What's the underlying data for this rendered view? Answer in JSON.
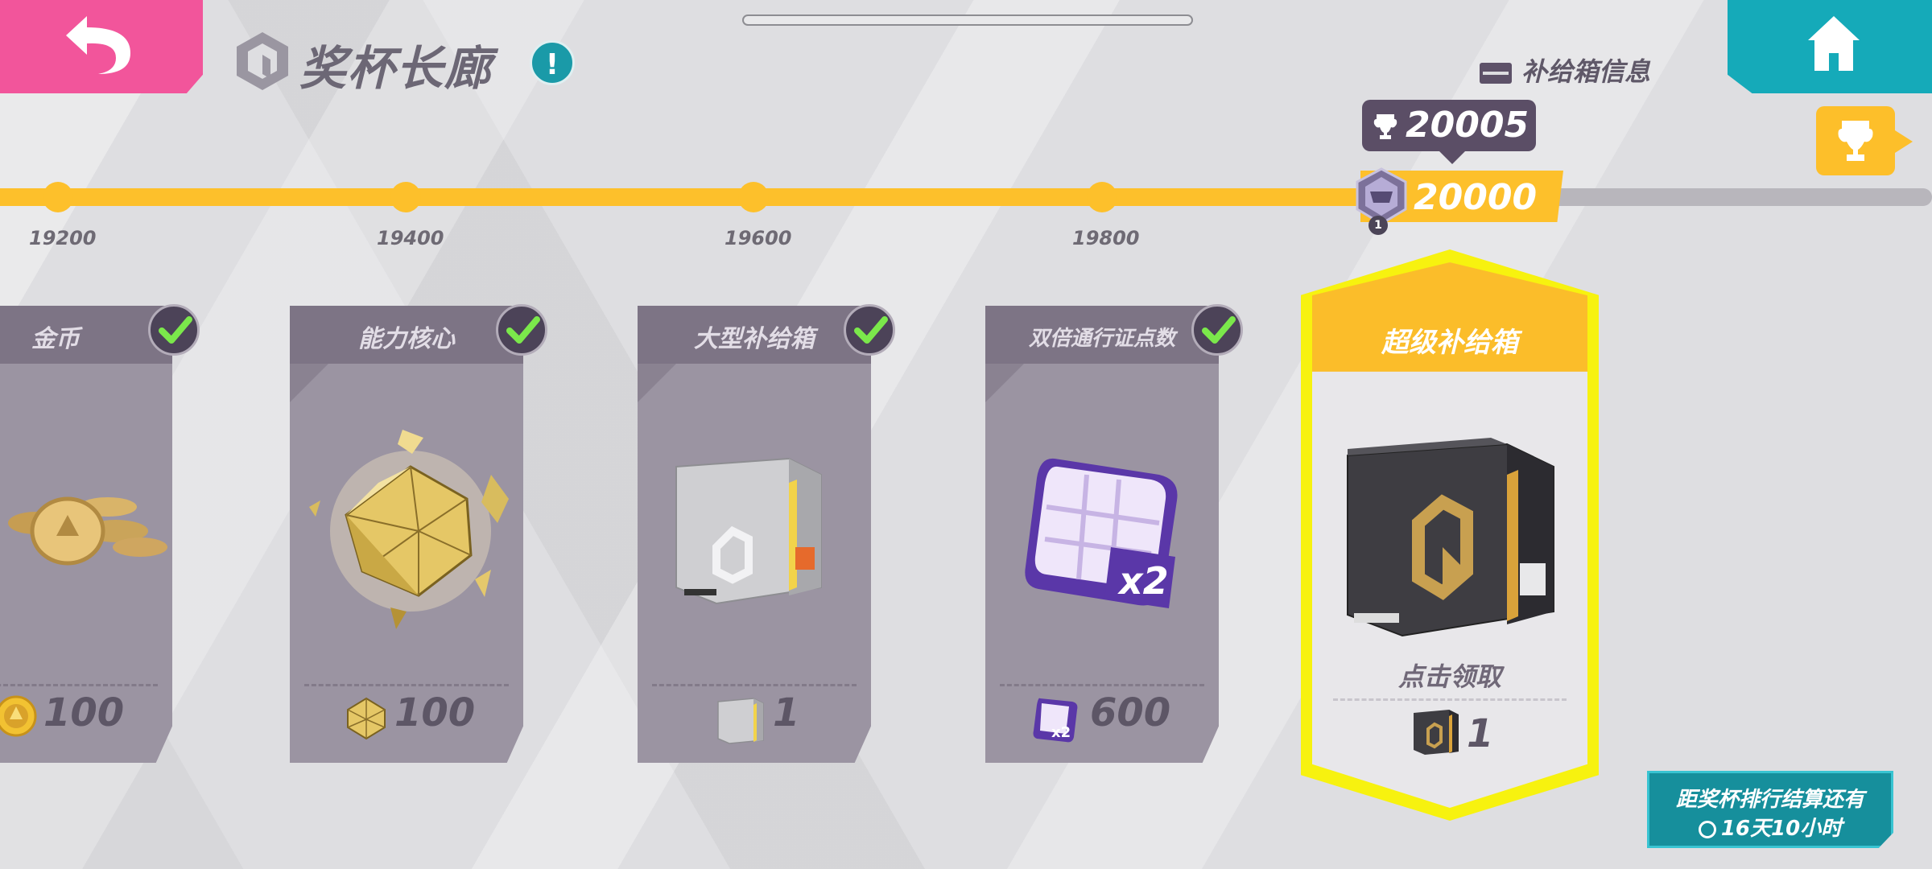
{
  "header": {
    "title": "奖杯长廊",
    "info_icon": "!",
    "supply_box_info": "补给箱信息"
  },
  "progress": {
    "current_trophies": "20005",
    "current_milestone": "20000",
    "rank_level": "1",
    "ticks": [
      "19200",
      "19400",
      "19600",
      "19800"
    ]
  },
  "rewards": [
    {
      "title": "金币",
      "count": "100",
      "claimed": true,
      "icon": "gold-coin-icon"
    },
    {
      "title": "能力核心",
      "count": "100",
      "claimed": true,
      "icon": "ability-core-icon"
    },
    {
      "title": "大型补给箱",
      "count": "1",
      "claimed": true,
      "icon": "large-supply-box-icon"
    },
    {
      "title": "双倍通行证点数",
      "count": "600",
      "claimed": true,
      "icon": "double-pass-points-icon"
    }
  ],
  "featured_reward": {
    "title": "超级补给箱",
    "action": "点击领取",
    "count": "1",
    "icon": "super-supply-box-icon"
  },
  "timer": {
    "line1": "距奖杯排行结算还有",
    "line2": "16天10小时"
  },
  "colors": {
    "accent_yellow": "#fdc02b",
    "back_pink": "#f2559b",
    "home_teal": "#15aab9",
    "card_purple": "#9b94a2"
  }
}
